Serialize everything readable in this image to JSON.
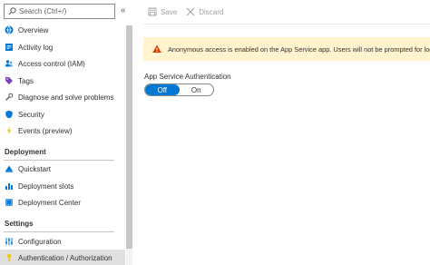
{
  "search": {
    "placeholder": "Search (Ctrl+/)"
  },
  "sidebar": {
    "collapse_glyph": "«",
    "items_top": [
      {
        "label": "Overview"
      },
      {
        "label": "Activity log"
      },
      {
        "label": "Access control (IAM)"
      },
      {
        "label": "Tags"
      },
      {
        "label": "Diagnose and solve problems"
      },
      {
        "label": "Security"
      },
      {
        "label": "Events (preview)"
      }
    ],
    "sections": [
      {
        "title": "Deployment",
        "items": [
          {
            "label": "Quickstart"
          },
          {
            "label": "Deployment slots"
          },
          {
            "label": "Deployment Center"
          }
        ]
      },
      {
        "title": "Settings",
        "items": [
          {
            "label": "Configuration"
          },
          {
            "label": "Authentication / Authorization"
          }
        ]
      }
    ]
  },
  "toolbar": {
    "save_label": "Save",
    "discard_label": "Discard"
  },
  "alert": {
    "text": "Anonymous access is enabled on the App Service app. Users will not be prompted for login."
  },
  "auth": {
    "label": "App Service Authentication",
    "off_label": "Off",
    "on_label": "On",
    "selected": "Off"
  },
  "colors": {
    "accent": "#0078d4",
    "alert_bg": "#fff4ce",
    "warning": "#d83b01"
  }
}
